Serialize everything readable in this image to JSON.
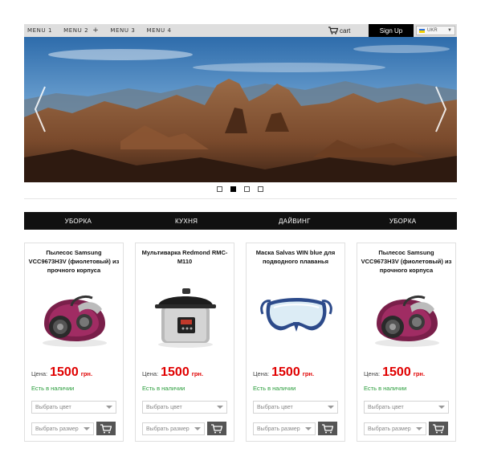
{
  "header": {
    "menu": [
      {
        "label": "MENU 1"
      },
      {
        "label": "MENU 2",
        "plus": "+"
      },
      {
        "label": "MENU 3"
      },
      {
        "label": "MENU 4"
      }
    ],
    "cart_label": "cart",
    "signup_label": "Sign Up",
    "language": "UKR"
  },
  "slider": {
    "slides": 4,
    "active_index": 1
  },
  "categories": [
    "УБОРКА",
    "КУХНЯ",
    "ДАЙВИНГ",
    "УБОРКА"
  ],
  "products": [
    {
      "title": "Пылесос Samsung VCC9673H3V (фиолетовый) из прочного корпуса",
      "image": "vacuum-image",
      "price_label": "Цена:",
      "price": "1500",
      "currency": "грн.",
      "stock": "Есть в наличии",
      "color_placeholder": "Выбрать цвет",
      "size_placeholder": "Выбрать размер"
    },
    {
      "title": "Мультиварка Redmond RMC-M110",
      "image": "multicooker-image",
      "price_label": "Цена:",
      "price": "1500",
      "currency": "грн.",
      "stock": "Есть в наличии",
      "color_placeholder": "Выбрать цвет",
      "size_placeholder": "Выбрать размер"
    },
    {
      "title": "Маска Salvas WIN blue для подводного плаванья",
      "image": "diving-mask-image",
      "price_label": "Цена:",
      "price": "1500",
      "currency": "грн.",
      "stock": "Есть в наличии",
      "color_placeholder": "Выбрать цвет",
      "size_placeholder": "Выбрать размер"
    },
    {
      "title": "Пылесос Samsung VCC9673H3V (фиолетовый) из прочного корпуса",
      "image": "vacuum-image",
      "price_label": "Цена:",
      "price": "1500",
      "currency": "грн.",
      "stock": "Есть в наличии",
      "color_placeholder": "Выбрать цвет",
      "size_placeholder": "Выбрать размер"
    }
  ],
  "colors": {
    "price": "#e00000",
    "stock": "#2a9d3c",
    "nav_bar": "#111111",
    "signup_bg": "#000000"
  }
}
